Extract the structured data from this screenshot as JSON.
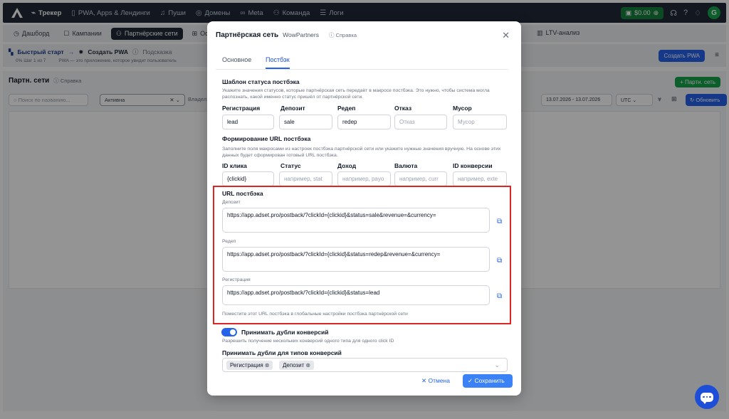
{
  "topbar": {
    "nav": [
      {
        "label": "Трекер",
        "icon": "chart-line-icon"
      },
      {
        "label": "PWA, Apps & Лендинги",
        "icon": "phone-icon"
      },
      {
        "label": "Пуши",
        "icon": "bell-icon"
      },
      {
        "label": "Домены",
        "icon": "globe-icon"
      },
      {
        "label": "Meta",
        "icon": "infinity-icon"
      },
      {
        "label": "Команда",
        "icon": "users-icon"
      },
      {
        "label": "Логи",
        "icon": "list-icon"
      }
    ],
    "balance": "$0.00",
    "avatar_letter": "G"
  },
  "subnav": {
    "tabs": [
      {
        "label": "Дашборд",
        "icon": "clock-icon"
      },
      {
        "label": "Кампании",
        "icon": "edit-icon"
      },
      {
        "label": "Партнёрские сети",
        "icon": "users-icon"
      },
      {
        "label": "Офф",
        "icon": "gift-icon"
      }
    ],
    "ltv": "LTV-анализ"
  },
  "quickstart": {
    "title": "Быстрый старт",
    "step": "Создать PWA",
    "hint": "Подсказка",
    "progress": "0%  Шаг 1 из 7",
    "step_desc": "PWA — это приложение, которое увидит пользователь",
    "create_button": "Создать PWA"
  },
  "page": {
    "title": "Партн. сети",
    "help": "Справка",
    "add_button": "Партн. сеть",
    "search_placeholder": "Поиск по названию...",
    "status_filter": "Активна",
    "owner_filter": "Владел",
    "date_range": "13.07.2026 - 13.07.2026",
    "timezone": "UTC",
    "refresh_button": "Обновить"
  },
  "modal": {
    "title": "Партнёрская сеть",
    "partner_name": "WowPartners",
    "help": "Справка",
    "tabs": [
      "Основное",
      "Постбэк"
    ],
    "active_tab": "Постбэк",
    "status_template": {
      "title": "Шаблон статуса постбэка",
      "desc": "Укажите значения статусов, которые партнёрская сеть передаёт в макросе постбэка. Это нужно, чтобы система могла распознать, какой именно статус пришёл от партнёрской сети.",
      "fields": [
        {
          "label": "Регистрация",
          "value": "lead",
          "placeholder": ""
        },
        {
          "label": "Депозит",
          "value": "sale",
          "placeholder": ""
        },
        {
          "label": "Редеп",
          "value": "redep",
          "placeholder": ""
        },
        {
          "label": "Отказ",
          "value": "",
          "placeholder": "Отказ"
        },
        {
          "label": "Мусор",
          "value": "",
          "placeholder": "Мусор"
        }
      ]
    },
    "url_build": {
      "title": "Формирование URL постбэка",
      "desc": "Заполните поля макросами из настроек постбэка партнёрской сети или укажите нужные значения вручную. На основе этих данных будет сформирован готовый URL постбэка.",
      "fields": [
        {
          "label": "ID клика",
          "value": "{clickid}",
          "placeholder": ""
        },
        {
          "label": "Статус",
          "value": "",
          "placeholder": "например, stat"
        },
        {
          "label": "Доход",
          "value": "",
          "placeholder": "например, payo"
        },
        {
          "label": "Валюта",
          "value": "",
          "placeholder": "например, curr"
        },
        {
          "label": "ID конверсии",
          "value": "",
          "placeholder": "например, exte"
        }
      ]
    },
    "postback_url": {
      "title": "URL постбэка",
      "items": [
        {
          "label": "Депозит",
          "url": "https://app.adset.pro/postback/?clickId={clickid}&status=sale&revenue=&currency="
        },
        {
          "label": "Редеп",
          "url": "https://app.adset.pro/postback/?clickId={clickid}&status=redep&revenue=&currency="
        },
        {
          "label": "Регистрация",
          "url": "https://app.adset.pro/postback/?clickId={clickid}&status=lead"
        }
      ],
      "note": "Поместите этот URL постбэка в глобальные настройки постбэка партнёрской сети"
    },
    "duplicates": {
      "toggle_label": "Принимать дубли конверсий",
      "toggle_desc": "Разрешить получение нескольких конверсий одного типа для одного click ID",
      "enabled": true,
      "types_title": "Принимать дубли для типов конверсий",
      "types": [
        "Регистрация",
        "Депозит"
      ]
    },
    "cancel": "Отмена",
    "save": "Сохранить"
  },
  "colors": {
    "accent": "#2563eb",
    "highlight_border": "#dc2626",
    "topbar": "#1f2937"
  }
}
